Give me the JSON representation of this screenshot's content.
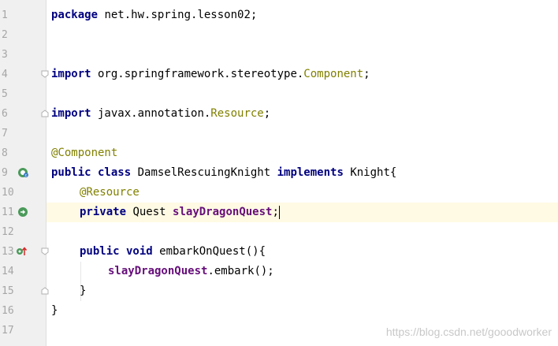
{
  "editor": {
    "line_numbers": [
      "1",
      "2",
      "3",
      "4",
      "5",
      "6",
      "7",
      "8",
      "9",
      "10",
      "11",
      "12",
      "13",
      "14",
      "15",
      "16",
      "17"
    ],
    "lines": {
      "l1": {
        "kw": "package",
        "rest": " net.hw.spring.lesson02;"
      },
      "l4": {
        "kw": "import",
        "pkg": " org.springframework.stereotype.",
        "cls": "Component",
        "end": ";"
      },
      "l6": {
        "kw": "import",
        "pkg": " javax.annotation.",
        "cls": "Resource",
        "end": ";"
      },
      "l8": {
        "ann": "@Component"
      },
      "l9": {
        "kw1": "public class",
        "name": " DamselRescuingKnight ",
        "kw2": "implements",
        "rest": " Knight{"
      },
      "l10": {
        "ann": "@Resource"
      },
      "l11": {
        "kw": "private",
        "type": " Quest ",
        "field": "slayDragonQuest",
        "end": ";"
      },
      "l13": {
        "kw": "public void",
        "rest": " embarkOnQuest(){"
      },
      "l14": {
        "field": "slayDragonQuest",
        "rest": ".embark();"
      },
      "l15": {
        "rest": "}"
      },
      "l16": {
        "rest": "}"
      }
    }
  },
  "watermark": "https://blog.csdn.net/gooodworker",
  "colors": {
    "keyword": "#000080",
    "annotation": "#808000",
    "field": "#660e7a",
    "gutter_bg": "#f0f0f0",
    "current_line": "#fffae3"
  },
  "icons": {
    "l9": "bean-class-icon",
    "l11": "bean-injection-icon",
    "l13": "implements-method-icon"
  }
}
